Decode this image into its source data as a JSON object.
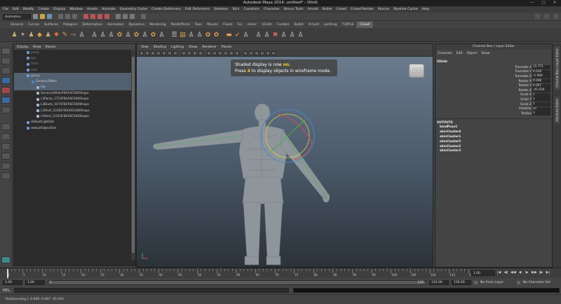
{
  "window": {
    "title": "Autodesk Maya 2014: untitled*   -   iShld\\",
    "controls": [
      "—",
      "□",
      "✕"
    ]
  },
  "menubar": [
    "File",
    "Edit",
    "Modify",
    "Create",
    "Display",
    "Window",
    "Assets",
    "Animate",
    "Geometry Cache",
    "Create Deformers",
    "Edit Deformers",
    "Skeleton",
    "Skin",
    "Constrain",
    "Character",
    "Bonus Tools",
    "Arnold",
    "Bullet",
    "Crowd",
    "Crowd Render",
    "Muscle",
    "Pipeline Cache",
    "Help"
  ],
  "status_line": {
    "mode": "Animation"
  },
  "shelf_tabs": [
    "General",
    "Curves",
    "Surfaces",
    "Polygons",
    "Deformation",
    "Animation",
    "Dynamics",
    "Rendering",
    "PaintEffects",
    "Toon",
    "Muscle",
    "Fluids",
    "Fur",
    "miner",
    "nCloth",
    "Custom",
    "Bullet",
    "Arnold",
    "yanfeng",
    "TURTLE",
    "Crowd"
  ],
  "shelf_active": "Crowd",
  "outliner": {
    "menu": [
      "Display",
      "Show",
      "Panels"
    ],
    "rows": [
      {
        "label": "persp",
        "indent": 0,
        "state": "dim"
      },
      {
        "label": "top",
        "indent": 0,
        "state": "dim"
      },
      {
        "label": "front",
        "indent": 0,
        "state": "dim"
      },
      {
        "label": "side",
        "indent": 0,
        "state": "dim"
      },
      {
        "label": "group",
        "indent": 0,
        "state": "sel"
      },
      {
        "label": "Genesis2Male",
        "indent": 1,
        "state": "sel"
      },
      {
        "label": "hip",
        "indent": 2,
        "state": "sel"
      },
      {
        "label": "Genesis2MaleFBXASC046Shape",
        "indent": 2,
        "state": "normal"
      },
      {
        "label": "L3Pants_1753FBXASC046Shape",
        "indent": 2,
        "state": "normal"
      },
      {
        "label": "L3Boots_5073FBXASC046Shape",
        "indent": 2,
        "state": "normal"
      },
      {
        "label": "L3Shirt_10361FBXASC046Shape",
        "indent": 2,
        "state": "normal"
      },
      {
        "label": "L3Vest_12263FBXASC046Shape",
        "indent": 2,
        "state": "normal"
      },
      {
        "label": "defaultLightSet",
        "indent": 0,
        "state": "normal"
      },
      {
        "label": "defaultObjectSet",
        "indent": 0,
        "state": "normal"
      }
    ]
  },
  "viewport": {
    "menu": [
      "View",
      "Shading",
      "Lighting",
      "Show",
      "Renderer",
      "Panels"
    ],
    "toast_line1_pre": "Shaded display is now ",
    "toast_line1_hl": "on",
    "toast_line1_post": ".",
    "toast_line2_pre": "Press ",
    "toast_line2_hl": "4",
    "toast_line2_post": " to display objects in wireframe mode.",
    "view_cube": "FRONT"
  },
  "channel_box": {
    "title": "Channel Box / Layer Editor",
    "menu": [
      "Channels",
      "Edit",
      "Object",
      "Show"
    ],
    "object": "lShldr",
    "attributes": [
      {
        "name": "Translate X",
        "value": "15.771"
      },
      {
        "name": "Translate Y",
        "value": "0.039"
      },
      {
        "name": "Translate Z",
        "value": "-5.989"
      },
      {
        "name": "Rotate X",
        "value": "0.008"
      },
      {
        "name": "Rotate Y",
        "value": "0.067"
      },
      {
        "name": "Rotate Z",
        "value": "-45.016"
      },
      {
        "name": "Scale X",
        "value": "1"
      },
      {
        "name": "Scale Y",
        "value": "1"
      },
      {
        "name": "Scale Z",
        "value": "1"
      },
      {
        "name": "Visibility",
        "value": "on"
      },
      {
        "name": "Radius",
        "value": "3"
      }
    ],
    "outputs_label": "OUTPUTS",
    "outputs": [
      "bindPose1",
      "skinCluster4",
      "skinCluster1",
      "skinCluster5",
      "skinCluster2",
      "skinCluster3"
    ],
    "side_tabs": [
      "Channel Box / Layer Editor",
      "Attribute Editor"
    ]
  },
  "time_slider": {
    "tick_labels": [
      "1",
      "5",
      "10",
      "15",
      "20",
      "25",
      "30",
      "35",
      "40",
      "45",
      "50",
      "55",
      "60",
      "65",
      "70",
      "75",
      "80",
      "85",
      "90",
      "95",
      "100",
      "105",
      "110",
      "115",
      "120"
    ],
    "current_frame": "1.00",
    "playback": [
      "|◀",
      "◀|",
      "◀◀",
      "◀",
      "▶",
      "▶▶",
      "|▶",
      "▶|"
    ]
  },
  "range_slider": {
    "start": "1.00",
    "playback_start": "1.00",
    "range_start": "1",
    "range_end": "120",
    "playback_end": "120.00",
    "end": "150.00",
    "end2": "150.00",
    "anim_layer": "No Anim Layer",
    "character_set": "No Character Set"
  },
  "command_line": {
    "label": "MEL"
  },
  "help_line": "Rotation(deg.):   0.008     -0.067     -45.016",
  "colors": {
    "selection": "#52606f",
    "toast_highlight": "#f7d31e",
    "viewport_top": "#6d7f92",
    "viewport_bottom": "#2b3239"
  }
}
